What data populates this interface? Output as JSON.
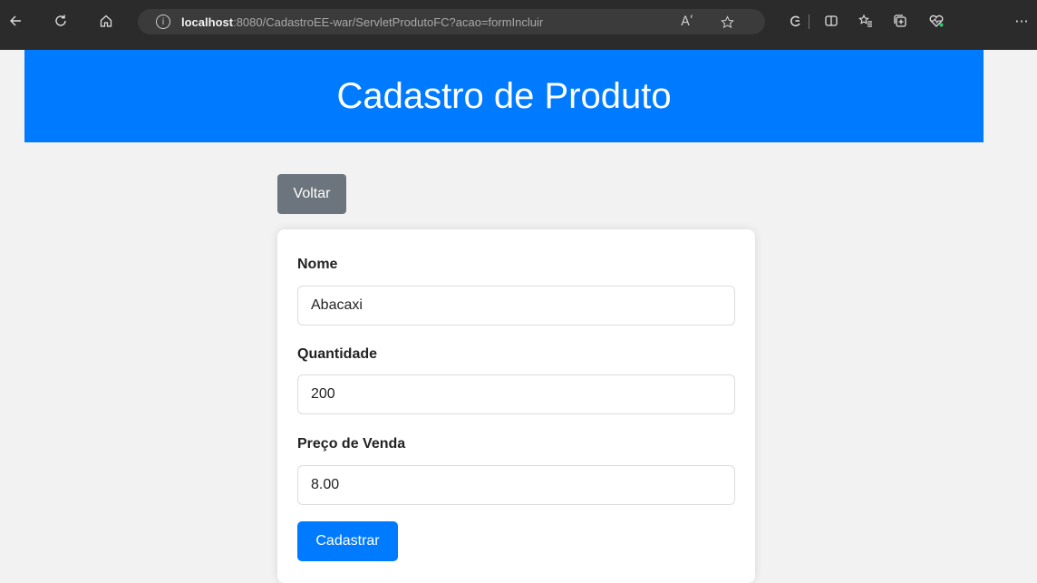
{
  "browser": {
    "url_host": "localhost",
    "url_rest": ":8080/CadastroEE-war/ServletProdutoFC?acao=formIncluir",
    "icons": [
      "back-icon",
      "refresh-icon",
      "home-icon",
      "info-icon",
      "read-aloud-icon",
      "favorite-icon",
      "extensions-icon",
      "split-screen-icon",
      "favorites-icon",
      "collections-icon",
      "health-icon",
      "more-icon"
    ],
    "read_aloud_glyph": "Aʹ",
    "more_glyph": "···"
  },
  "page": {
    "title": "Cadastro de Produto",
    "back_label": "Voltar"
  },
  "form": {
    "nome_label": "Nome",
    "nome_value": "Abacaxi",
    "quantidade_label": "Quantidade",
    "quantidade_value": "200",
    "preco_label": "Preço de Venda",
    "preco_value": "8.00",
    "submit_label": "Cadastrar"
  },
  "colors": {
    "header": "#007bff",
    "back_button": "#6c757d",
    "submit_button": "#007bff",
    "background": "#f2f2f2"
  }
}
